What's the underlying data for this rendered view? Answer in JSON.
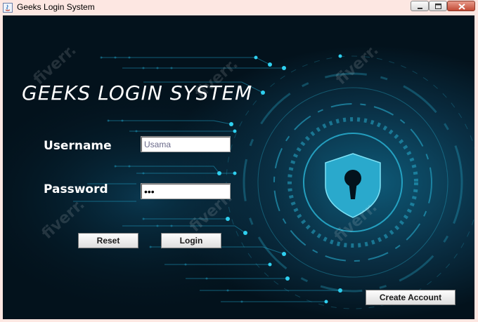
{
  "window": {
    "title": "Geeks Login System"
  },
  "form": {
    "heading": "GEEKS LOGIN SYSTEM",
    "username_label": "Username",
    "username_value": "Usama",
    "password_label": "Password",
    "password_value": "•••",
    "reset_label": "Reset",
    "login_label": "Login",
    "create_account_label": "Create Account"
  },
  "watermark": {
    "text": "fiverr."
  },
  "colors": {
    "background": "#041a26",
    "accent": "#23c4e6",
    "titlebar": "#fde7e2"
  }
}
